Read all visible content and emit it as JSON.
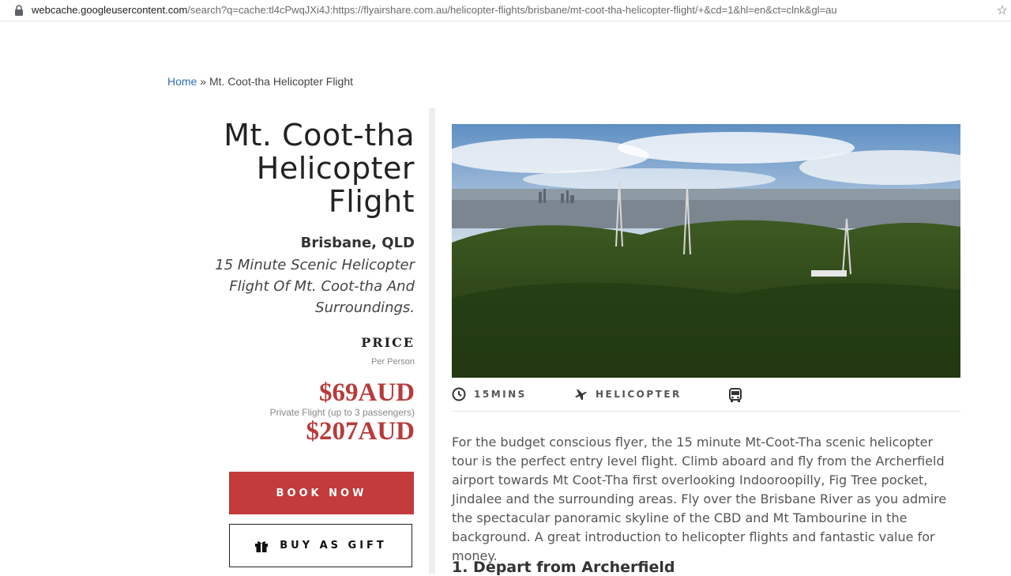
{
  "browser": {
    "url_host": "webcache.googleusercontent.com",
    "url_path": "/search?q=cache:tl4cPwqJXi4J:https://flyairshare.com.au/helicopter-flights/brisbane/mt-coot-tha-helicopter-flight/+&cd=1&hl=en&ct=clnk&gl=au"
  },
  "breadcrumb": {
    "home": "Home",
    "separator": " » ",
    "current": "Mt. Coot-tha Helicopter Flight"
  },
  "product": {
    "title_lines": [
      "Mt. Coot-tha",
      "Helicopter",
      "Flight"
    ],
    "location": "Brisbane, QLD",
    "subtitle": "15 Minute Scenic Helicopter Flight Of Mt. Coot-tha And Surroundings.",
    "price_label": "PRICE",
    "per_person": "Per Person",
    "price": "$69AUD",
    "private_note": "Private Flight (up to 3 passengers)",
    "private_price": "$207AUD",
    "book_label": "BOOK NOW",
    "gift_label": "BUY AS GIFT"
  },
  "meta": {
    "duration": "15MINS",
    "aircraft": "HELICOPTER"
  },
  "description": "For the budget conscious flyer, the 15 minute Mt-Coot-Tha scenic helicopter tour is the perfect entry level flight. Climb aboard and fly from the Archerfield airport towards Mt Coot-Tha first overlooking Indooroopilly, Fig Tree pocket, Jindalee and the surrounding areas. Fly over the Brisbane River as you admire the spectacular panoramic skyline of the CBD and Mt Tambourine in the background. A great introduction to helicopter flights and fantastic value for money.",
  "step_heading": "1. Depart from Archerfield",
  "colors": {
    "accent": "#c33b3b",
    "price": "#b83a3a",
    "link": "#2e6fb5"
  },
  "icons": {
    "lock": "lock-icon",
    "star": "bookmark-star-icon",
    "clock": "clock-icon",
    "plane": "plane-icon",
    "bus": "bus-icon",
    "gift": "gift-icon"
  }
}
